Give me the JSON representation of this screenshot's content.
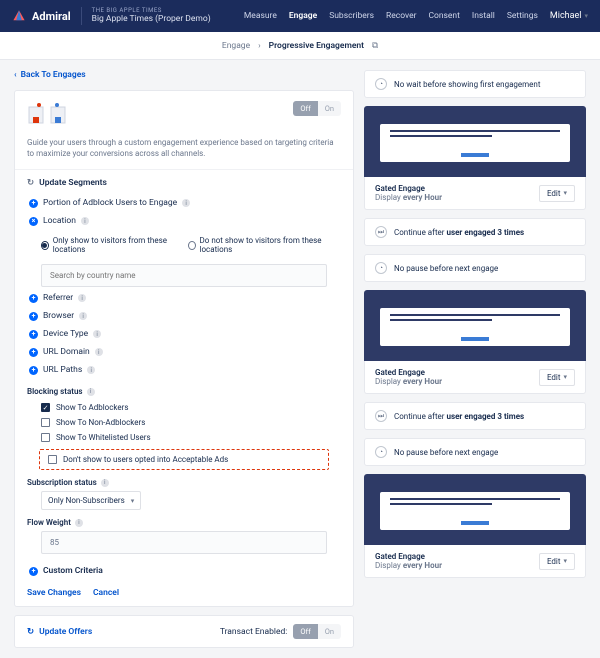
{
  "brand": "Admiral",
  "site": {
    "tag": "THE BIG APPLE TIMES",
    "name": "Big Apple Times (Proper Demo)"
  },
  "nav": {
    "items": [
      "Measure",
      "Engage",
      "Subscribers",
      "Recover",
      "Consent",
      "Install",
      "Settings"
    ],
    "user": "Michael"
  },
  "breadcrumb": {
    "parent": "Engage",
    "current": "Progressive Engagement"
  },
  "back": "Back To Engages",
  "toggle": {
    "off": "Off",
    "on": "On"
  },
  "intro": "Guide your users through a custom engagement experience based on targeting criteria to maximize your conversions across all channels.",
  "segments": {
    "title": "Update Segments",
    "portion": "Portion of Adblock Users to Engage",
    "location": {
      "label": "Location",
      "opt1": "Only show to visitors from these locations",
      "opt2": "Do not show to visitors from these locations",
      "placeholder": "Search by country name"
    },
    "referrer": "Referrer",
    "browser": "Browser",
    "device": "Device Type",
    "urldomain": "URL Domain",
    "urlpaths": "URL Paths",
    "blocking": {
      "label": "Blocking status",
      "c1": "Show To Adblockers",
      "c2": "Show To Non-Adblockers",
      "c3": "Show To Whitelisted Users",
      "c4": "Don't show to users opted into Acceptable Ads"
    },
    "subscription": {
      "label": "Subscription status",
      "value": "Only Non-Subscribers"
    },
    "flow": {
      "label": "Flow Weight",
      "value": "85"
    },
    "custom": "Custom Criteria",
    "save": "Save Changes",
    "cancel": "Cancel"
  },
  "offers": {
    "title": "Update Offers",
    "transact": "Transact Enabled:"
  },
  "right": {
    "nowait": "No wait before showing first engagement",
    "gated": "Gated Engage",
    "every": "Display ",
    "everyB": "every Hour",
    "edit": "Edit",
    "continueA": "Continue after ",
    "continueB": "user engaged 3 times",
    "nopause": "No pause before next engage"
  }
}
